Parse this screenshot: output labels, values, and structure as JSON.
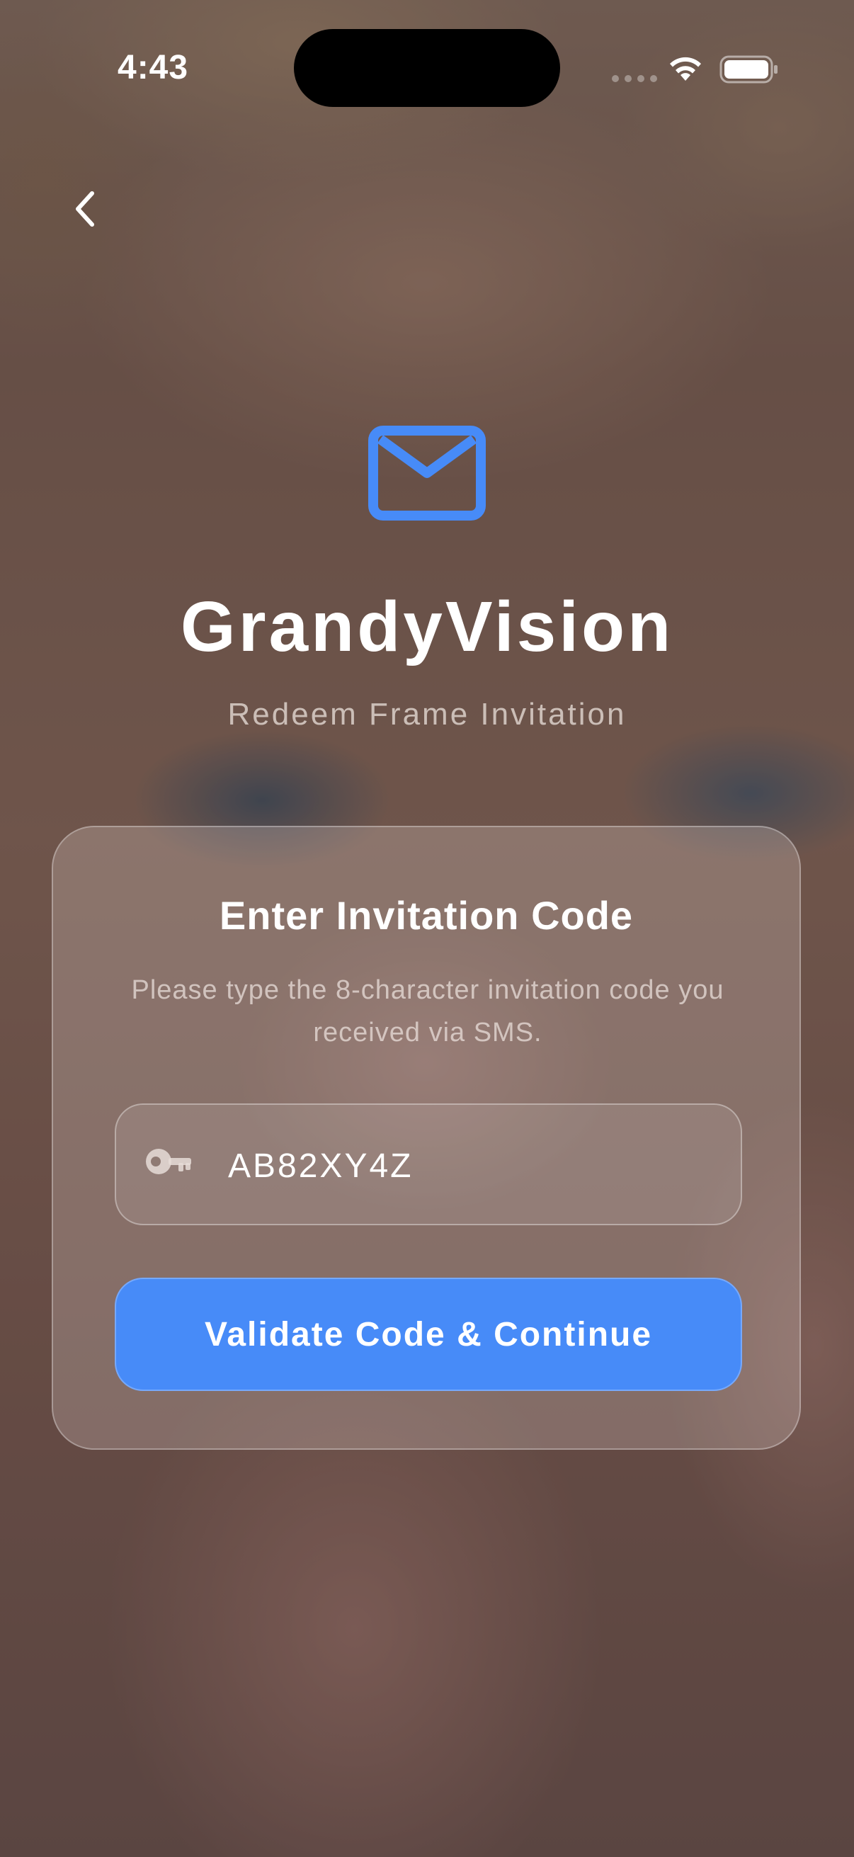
{
  "status_bar": {
    "time": "4:43"
  },
  "navigation": {
    "back_icon": "chevron-left-icon"
  },
  "header": {
    "icon": "envelope-icon",
    "title": "GrandyVision",
    "subtitle": "Redeem Frame Invitation"
  },
  "card": {
    "title": "Enter Invitation Code",
    "description": "Please type the 8-character invitation code you received via SMS.",
    "code_field": {
      "icon": "key-icon",
      "value": "AB82XY4Z"
    },
    "submit_label": "Validate Code & Continue"
  },
  "colors": {
    "accent": "#478bf8",
    "text": "#ffffff"
  }
}
